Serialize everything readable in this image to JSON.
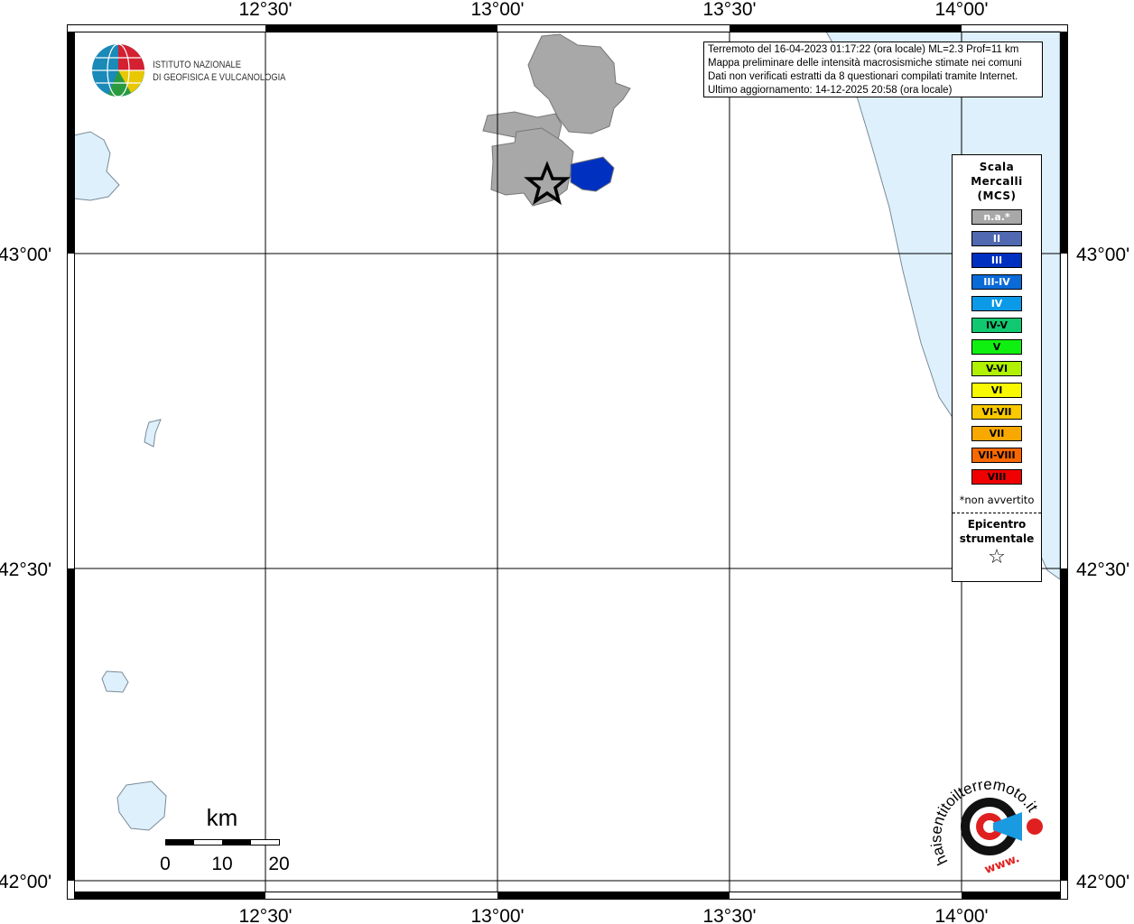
{
  "map": {
    "lon_ticks": [
      "12°30'",
      "13°00'",
      "13°30'",
      "14°00'"
    ],
    "lat_ticks": [
      "43°00'",
      "42°30'",
      "42°00'"
    ]
  },
  "logo": {
    "line1": "ISTITUTO NAZIONALE",
    "line2": "DI GEOFISICA E VULCANOLOGIA"
  },
  "info": {
    "lines": [
      "Terremoto del 16-04-2023 01:17:22 (ora locale) ML=2.3 Prof=11 km",
      "Mappa preliminare delle intensità macrosismiche stimate nei comuni",
      "Dati non verificati estratti da 8 questionari compilati tramite Internet.",
      "Ultimo aggiornamento: 14-12-2025 20:58 (ora locale)"
    ]
  },
  "legend": {
    "title": [
      "Scala",
      "Mercalli",
      "(MCS)"
    ],
    "classes": [
      {
        "label": "n.a.*",
        "color": "#a8a8a8",
        "text": "#fff"
      },
      {
        "label": "II",
        "color": "#5069b0",
        "text": "#fff"
      },
      {
        "label": "III",
        "color": "#0030c0",
        "text": "#fff"
      },
      {
        "label": "III-IV",
        "color": "#0a6ad8",
        "text": "#fff"
      },
      {
        "label": "IV",
        "color": "#0a9ae8",
        "text": "#fff"
      },
      {
        "label": "IV-V",
        "color": "#10c870",
        "text": "#000"
      },
      {
        "label": "V",
        "color": "#10f010",
        "text": "#000"
      },
      {
        "label": "V-VI",
        "color": "#b0f000",
        "text": "#000"
      },
      {
        "label": "VI",
        "color": "#f8f800",
        "text": "#000"
      },
      {
        "label": "VI-VII",
        "color": "#f8c800",
        "text": "#000"
      },
      {
        "label": "VII",
        "color": "#f8a800",
        "text": "#000"
      },
      {
        "label": "VII-VIII",
        "color": "#f86800",
        "text": "#000"
      },
      {
        "label": "VIII",
        "color": "#f00000",
        "text": "#000"
      }
    ],
    "note": "*non avvertito",
    "epicenter": [
      "Epicentro",
      "strumentale"
    ],
    "epicenter_symbol": "☆"
  },
  "scale": {
    "unit": "km",
    "ticks": [
      "0",
      "10",
      "20"
    ]
  },
  "site_logo": {
    "text": "haisentitoilterremoto.it",
    "www": "www."
  },
  "colors": {
    "sea": "#ddf0fc",
    "coast": "#7a8a98",
    "grid": "#000"
  }
}
